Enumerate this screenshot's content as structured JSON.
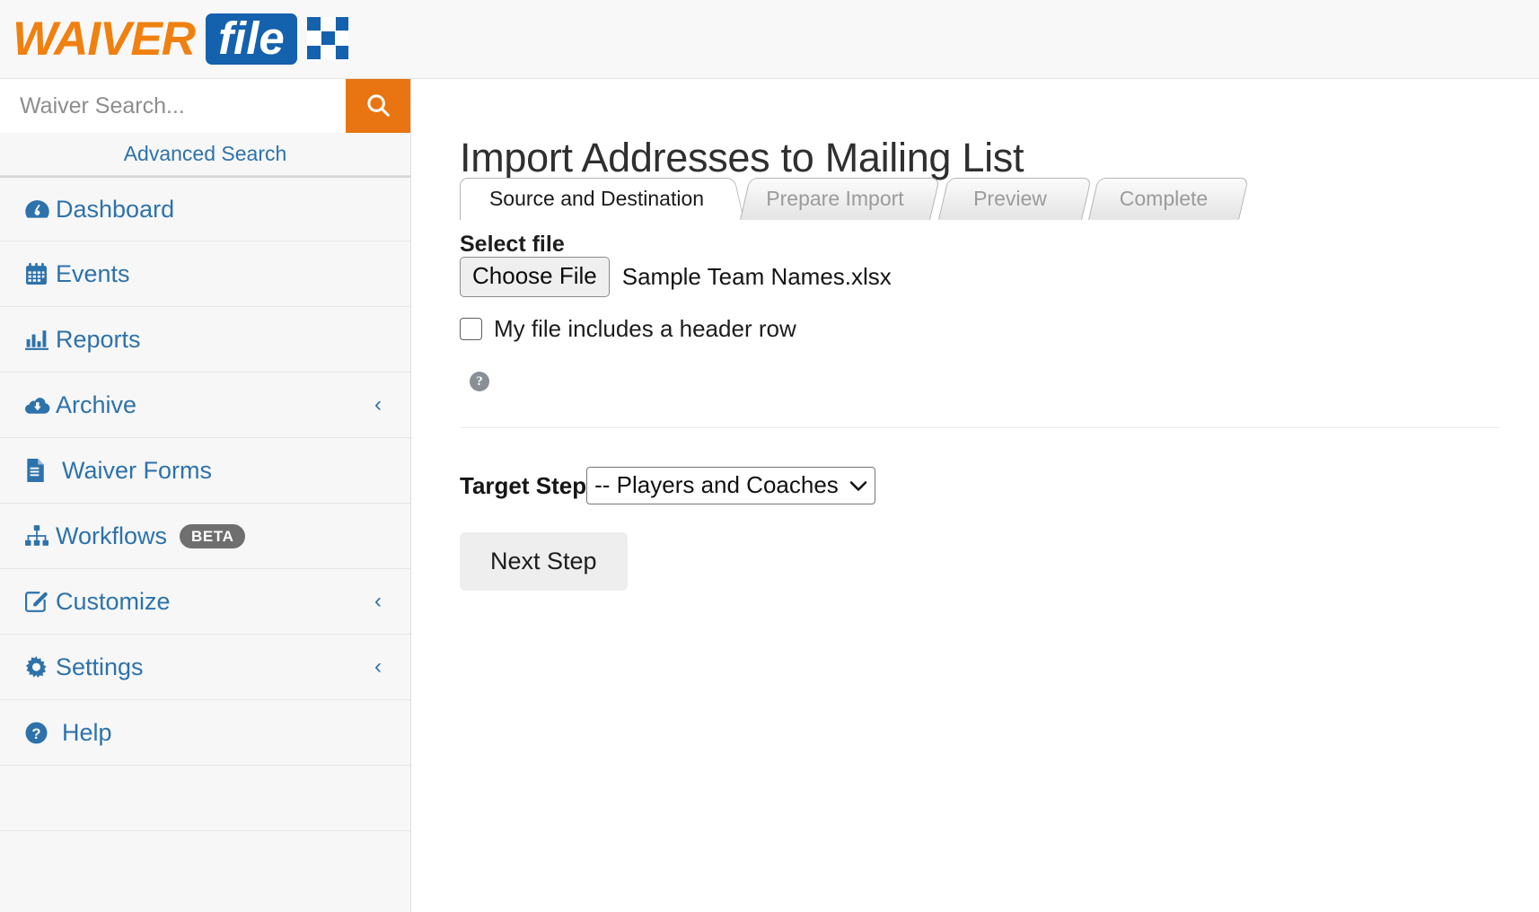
{
  "brand": {
    "logo_waiver": "WAIVER",
    "logo_file": "file"
  },
  "search": {
    "placeholder": "Waiver Search...",
    "value": "",
    "button_icon": "search-icon",
    "advanced_link": "Advanced Search"
  },
  "sidebar": {
    "items": [
      {
        "label": "Dashboard",
        "icon": "dashboard-icon",
        "chevron": "",
        "badge": ""
      },
      {
        "label": "Events",
        "icon": "calendar-icon",
        "chevron": "",
        "badge": ""
      },
      {
        "label": "Reports",
        "icon": "bar-chart-icon",
        "chevron": "",
        "badge": ""
      },
      {
        "label": "Archive",
        "icon": "cloud-download-icon",
        "chevron": "‹",
        "badge": ""
      },
      {
        "label": "Waiver Forms",
        "icon": "document-icon",
        "chevron": "",
        "badge": ""
      },
      {
        "label": "Workflows",
        "icon": "sitemap-icon",
        "chevron": "",
        "badge": "BETA"
      },
      {
        "label": "Customize",
        "icon": "edit-square-icon",
        "chevron": "‹",
        "badge": ""
      },
      {
        "label": "Settings",
        "icon": "gear-icon",
        "chevron": "‹",
        "badge": ""
      },
      {
        "label": "Help",
        "icon": "question-circle-icon",
        "chevron": "",
        "badge": ""
      }
    ]
  },
  "main": {
    "title": "Import Addresses to Mailing List",
    "tabs": [
      {
        "label": "Source and Destination",
        "active": true
      },
      {
        "label": "Prepare Import",
        "active": false
      },
      {
        "label": "Preview",
        "active": false
      },
      {
        "label": "Complete",
        "active": false
      }
    ],
    "select_file_label": "Select file",
    "choose_file_button": "Choose File",
    "file_name": "Sample Team Names.xlsx",
    "header_row_checkbox_label": "My file includes a header row",
    "header_row_checked": false,
    "help_icon_glyph": "?",
    "target_step_label": "Target Step",
    "target_step_value": "-- Players and Coaches",
    "target_step_caret": "⌄",
    "next_button": "Next Step"
  },
  "colors": {
    "brand_orange": "#f08010",
    "brand_blue": "#1461ad",
    "link_blue": "#2d72ab",
    "search_button": "#e87511",
    "badge_gray": "#6f6f6f"
  }
}
